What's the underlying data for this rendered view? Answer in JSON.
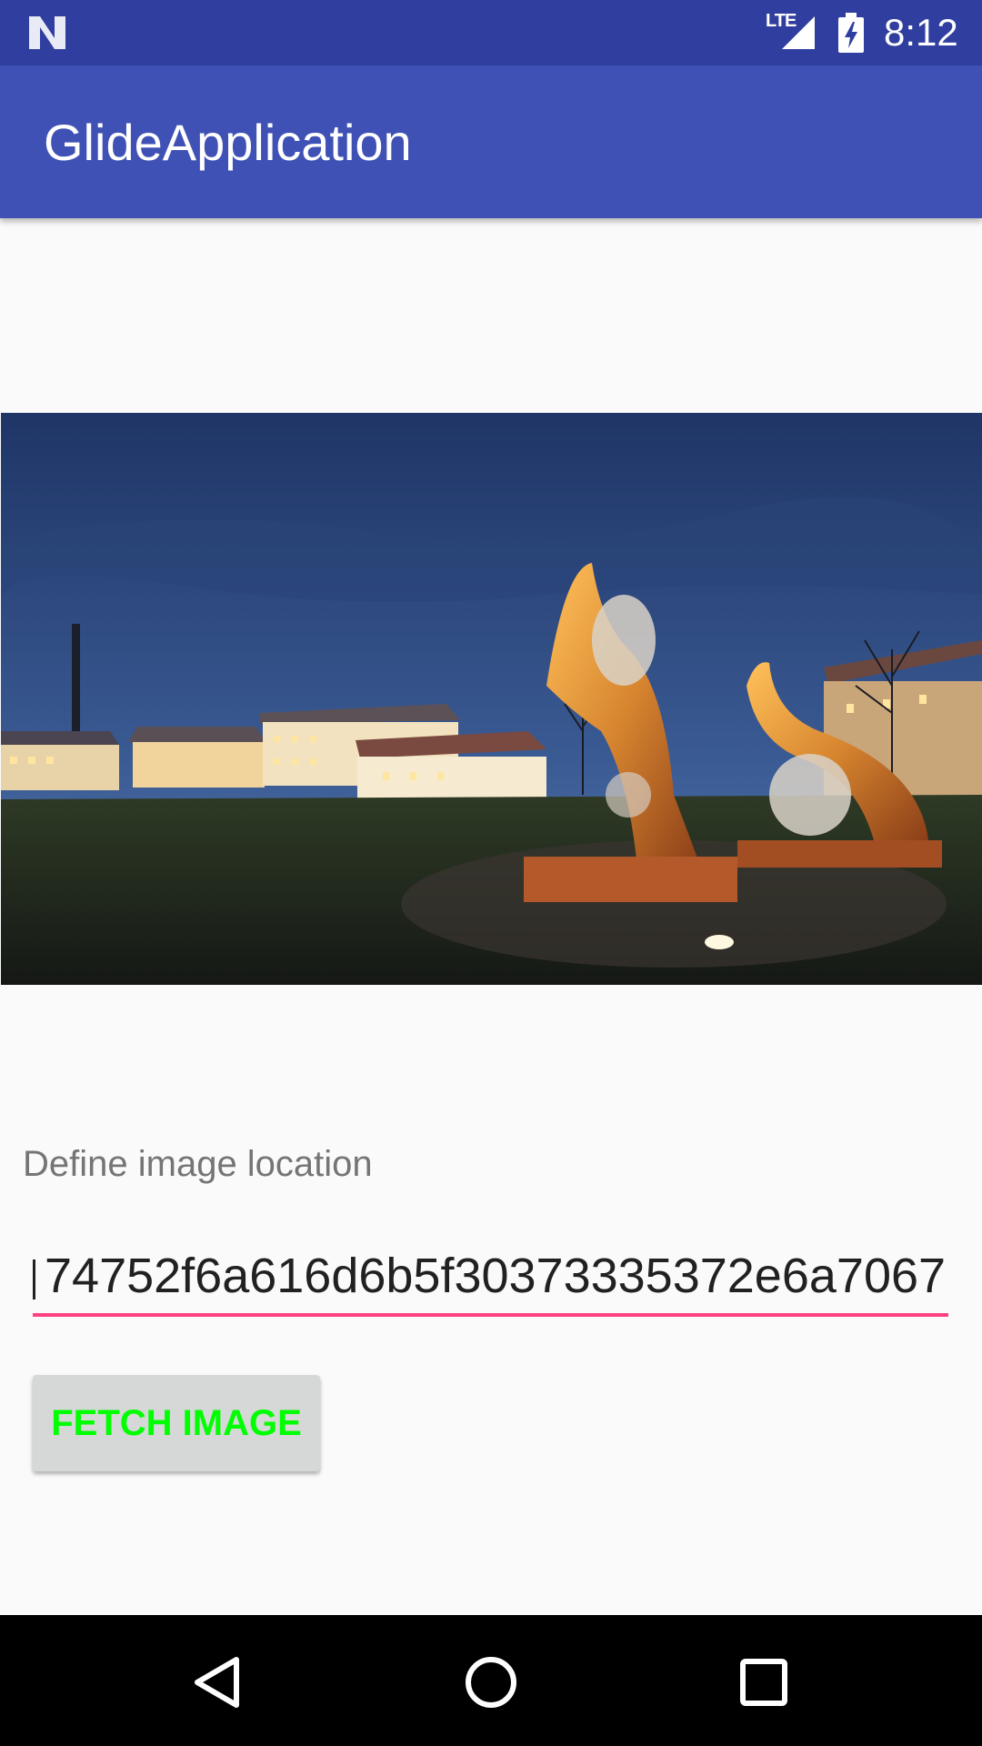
{
  "status_bar": {
    "network": "LTE",
    "time": "8:12",
    "icons": [
      "android-n-icon",
      "lte-signal-icon",
      "battery-charging-icon"
    ]
  },
  "app_bar": {
    "title": "GlideApplication",
    "color": "#3f51b5"
  },
  "main": {
    "image_alt": "night photo of orange sculptures in front of lit buildings",
    "field_label": "Define image location",
    "url_value": "74752f6a616d6b5f30373335372e6a7067",
    "fetch_button_label": "FETCH IMAGE",
    "accent_color": "#ff4081",
    "button_text_color": "#00ff00"
  },
  "nav_bar": {
    "icons": [
      "back-icon",
      "home-icon",
      "recents-icon"
    ]
  }
}
